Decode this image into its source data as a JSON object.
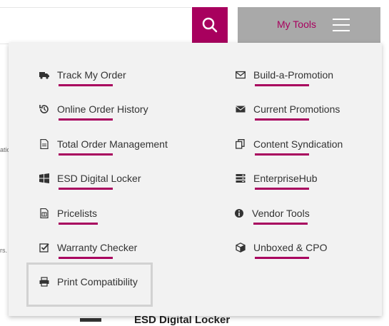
{
  "header": {
    "search_button_icon": "search-icon",
    "tools_label": "My Tools",
    "menu_icon": "hamburger-icon",
    "accent_color": "#a8005e"
  },
  "background": {
    "fragment_1": "atio",
    "fragment_2": "rs.",
    "bottom_heading": "ESD Digital Locker"
  },
  "menu": {
    "left": [
      {
        "label": "Track My Order",
        "icon": "truck-icon"
      },
      {
        "label": "Online Order History",
        "icon": "history-icon"
      },
      {
        "label": "Total Order Management",
        "icon": "document-icon"
      },
      {
        "label": "ESD Digital Locker",
        "icon": "windows-icon"
      },
      {
        "label": "Pricelists",
        "icon": "spreadsheet-file-icon"
      },
      {
        "label": "Warranty Checker",
        "icon": "checkbox-icon"
      },
      {
        "label": "Print Compatibility",
        "icon": "printer-icon"
      }
    ],
    "right": [
      {
        "label": "Build-a-Promotion",
        "icon": "envelope-outline-icon"
      },
      {
        "label": "Current Promotions",
        "icon": "envelope-icon"
      },
      {
        "label": "Content Syndication",
        "icon": "copy-icon"
      },
      {
        "label": "EnterpriseHub",
        "icon": "server-icon"
      },
      {
        "label": "Vendor Tools",
        "icon": "info-icon"
      },
      {
        "label": "Unboxed & CPO",
        "icon": "cube-icon"
      }
    ]
  }
}
